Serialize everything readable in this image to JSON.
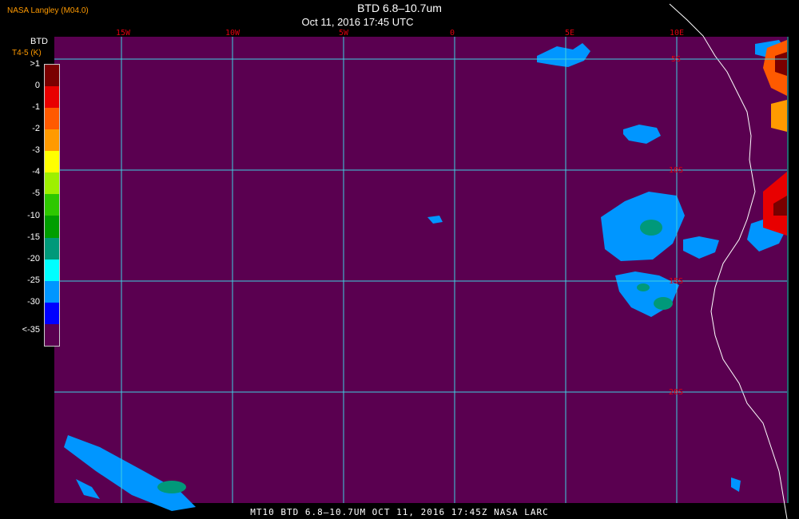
{
  "credit": "NASA Langley (M04.0)",
  "title": "BTD 6.8–10.7um",
  "subtitle": "Oct 11, 2016 17:45 UTC",
  "footer": "MT10  BTD 6.8–10.7UM  OCT 11, 2016 17:45Z  NASA LARC",
  "legend": {
    "title": "BTD",
    "units": "T4-5 (K)",
    "labels": [
      ">1",
      "0",
      "-1",
      "-2",
      "-3",
      "-4",
      "-5",
      "-10",
      "-15",
      "-20",
      "-25",
      "-30",
      "<-35"
    ],
    "colors": [
      "#7a0000",
      "#e80000",
      "#ff5a00",
      "#ff9a00",
      "#ffff00",
      "#9ef000",
      "#2ec800",
      "#009e00",
      "#00997a",
      "#00ffff",
      "#0096ff",
      "#0000ff",
      "#5a0050"
    ]
  },
  "map": {
    "background_color": "#5a0050",
    "grid_color": "#3fd0e0",
    "lon_labels": [
      "15W",
      "10W",
      "5W",
      "0",
      "5E",
      "10E"
    ],
    "lat_labels": [
      "5S",
      "10S",
      "15S",
      "20S"
    ]
  }
}
